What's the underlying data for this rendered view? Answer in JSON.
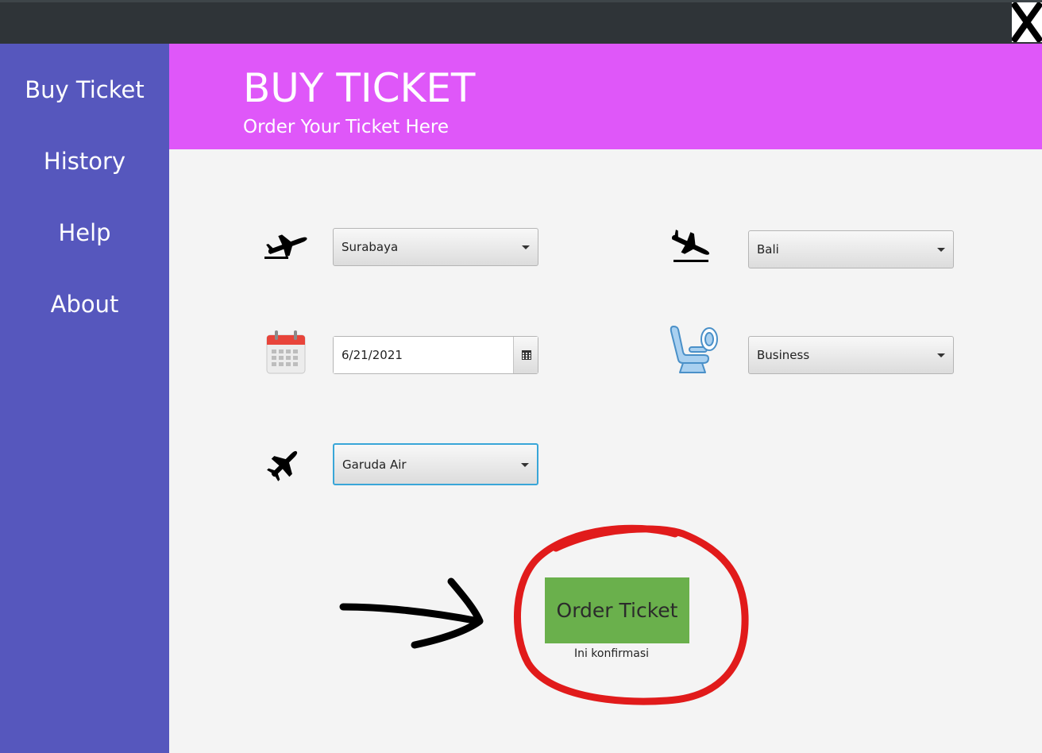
{
  "sidebar": {
    "items": [
      {
        "label": "Buy Ticket"
      },
      {
        "label": "History"
      },
      {
        "label": "Help"
      },
      {
        "label": "About"
      }
    ]
  },
  "header": {
    "title": "BUY TICKET",
    "subtitle": "Order Your Ticket Here"
  },
  "form": {
    "origin": {
      "icon": "airplane-takeoff-icon",
      "value": "Surabaya"
    },
    "destination": {
      "icon": "airplane-landing-icon",
      "value": "Bali"
    },
    "date": {
      "icon": "calendar-icon",
      "value": "6/21/2021"
    },
    "seat_class": {
      "icon": "airplane-seat-icon",
      "value": "Business"
    },
    "airline": {
      "icon": "airplane-icon",
      "value": "Garuda Air"
    }
  },
  "actions": {
    "order_label": "Order Ticket",
    "confirm_label": "Ini konfirmasi"
  },
  "colors": {
    "titlebar": "#2f3438",
    "sidebar": "#5657bd",
    "header": "#df57f9",
    "order_button": "#6ab04c",
    "annotation_circle": "#e11b1b",
    "annotation_arrow": "#000000"
  }
}
